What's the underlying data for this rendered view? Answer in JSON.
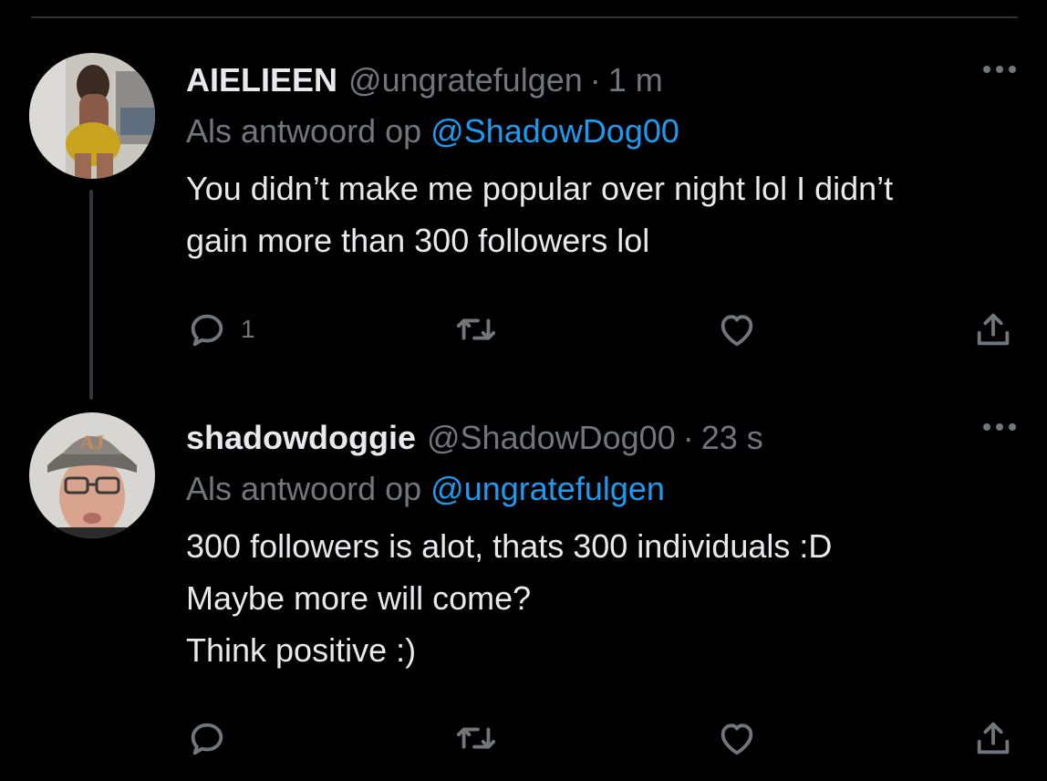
{
  "tweets": [
    {
      "name": "AIELIEEN",
      "handle": "@ungratefulgen",
      "separator": "·",
      "time": "1 m",
      "reply_prefix": "Als antwoord op",
      "reply_to": "@ShadowDog00",
      "body_lines": [
        "You didn’t make me popular over night lol I didn’t",
        "gain more than 300 followers lol"
      ],
      "reply_count": "1",
      "avatar": "user-photo-avatar"
    },
    {
      "name": "shadowdoggie",
      "handle": "@ShadowDog00",
      "separator": "·",
      "time": "23 s",
      "reply_prefix": "Als antwoord op",
      "reply_to": "@ungratefulgen",
      "body_lines": [
        "300 followers is alot, thats 300 individuals :D",
        "Maybe more will come?",
        "Think positive :)"
      ],
      "reply_count": "",
      "avatar": "user-photo-avatar",
      "cap_text": "AJ"
    }
  ],
  "icons": {
    "reply": "reply-icon",
    "retweet": "retweet-icon",
    "like": "like-icon",
    "share": "share-icon",
    "more": "more-icon"
  },
  "colors": {
    "background": "#000000",
    "text": "#e7e9ea",
    "muted": "#71767b",
    "link": "#1d9bf0",
    "divider": "#2f3336"
  }
}
